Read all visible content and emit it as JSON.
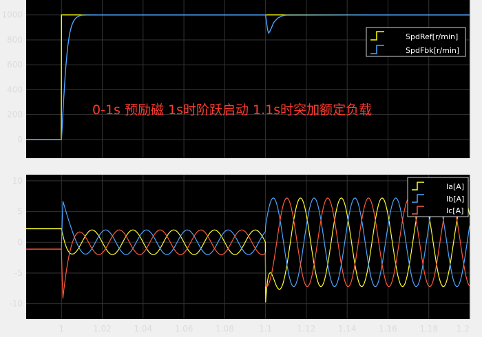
{
  "chart_data": [
    {
      "type": "line",
      "title": "",
      "xlabel": "",
      "ylabel": "",
      "xlim": [
        0.9827,
        1.2
      ],
      "ylim": [
        -150,
        1120
      ],
      "yticks": [
        "0",
        "200",
        "400",
        "600",
        "800",
        "1000"
      ],
      "grid": true,
      "legend_placement": "top-right",
      "annotation": "0-1s 预励磁  1s时阶跃启动  1.1s时突加额定负载",
      "series": [
        {
          "name": "SpdRef[r/min]",
          "color": "#ffff00",
          "x": [
            0.9827,
            0.99,
            0.9999,
            1.0,
            1.1,
            1.2
          ],
          "y": [
            0,
            0,
            0,
            1000,
            1000,
            1000
          ]
        },
        {
          "name": "SpdFbk[r/min]",
          "color": "#4da6ff",
          "x": [
            0.9827,
            0.99,
            1.0,
            1.001,
            1.002,
            1.003,
            1.004,
            1.005,
            1.006,
            1.007,
            1.008,
            1.009,
            1.01,
            1.015,
            1.02,
            1.05,
            1.1,
            1.1005,
            1.101,
            1.1015,
            1.102,
            1.103,
            1.104,
            1.106,
            1.108,
            1.11,
            1.15,
            1.2
          ],
          "y": [
            0,
            0,
            0,
            300,
            560,
            740,
            850,
            915,
            953,
            974,
            987,
            994,
            998,
            1000,
            1000,
            1000,
            1000,
            940,
            880,
            855,
            865,
            900,
            940,
            975,
            992,
            998,
            1000,
            1000
          ]
        }
      ]
    },
    {
      "type": "line",
      "title": "",
      "xlabel": "",
      "ylabel": "",
      "xlim": [
        0.9827,
        1.2
      ],
      "ylim": [
        -12.5,
        11
      ],
      "xticks": [
        "1",
        "1.02",
        "1.04",
        "1.06",
        "1.08",
        "1.1",
        "1.12",
        "1.14",
        "1.16",
        "1.18",
        "1.2"
      ],
      "yticks": [
        "-10",
        "-5",
        "0",
        "5",
        "10"
      ],
      "grid": true,
      "legend_placement": "top-right",
      "series": [
        {
          "name": "Ia[A]",
          "color": "#ffff33"
        },
        {
          "name": "Ib[A]",
          "color": "#4da6ff"
        },
        {
          "name": "Ic[A]",
          "color": "#ff5a3c"
        }
      ],
      "waveform": {
        "pre_excitation": {
          "t_end": 1.0,
          "Ia": 2.2,
          "Ib": -1.1,
          "Ic": -1.1
        },
        "startup_transient": {
          "t_start": 1.0,
          "t_end": 1.01,
          "Ia_peak": 2.2,
          "Ib_peak": 8.5,
          "Ic_peak": -10.2
        },
        "no_load": {
          "t_start": 1.01,
          "t_end": 1.1,
          "amplitude": 2.0,
          "frequency_hz": 50
        },
        "load_step": {
          "t_start": 1.1,
          "Ia_min": -10,
          "Ic_peak": 7.5,
          "amplitude": 7.2,
          "frequency_hz": 50
        }
      }
    }
  ]
}
